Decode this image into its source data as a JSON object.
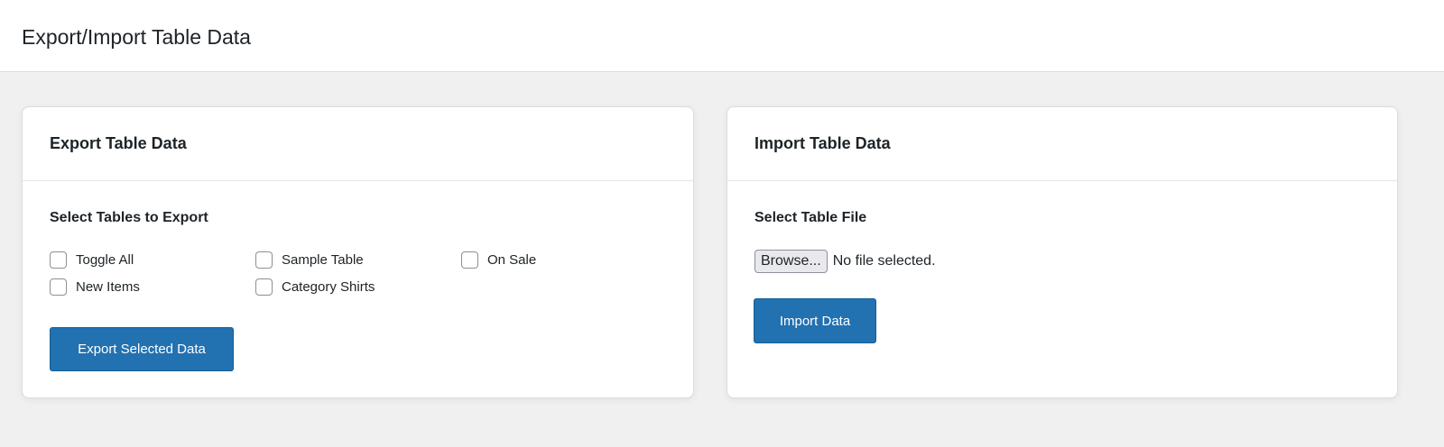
{
  "page_title": "Export/Import Table Data",
  "export": {
    "title": "Export Table Data",
    "section_label": "Select Tables to Export",
    "checkboxes": [
      {
        "label": "Toggle All",
        "checked": false
      },
      {
        "label": "Sample Table",
        "checked": false
      },
      {
        "label": "On Sale",
        "checked": false
      },
      {
        "label": "New Items",
        "checked": false
      },
      {
        "label": "Category Shirts",
        "checked": false
      }
    ],
    "button": "Export Selected Data"
  },
  "import": {
    "title": "Import Table Data",
    "section_label": "Select Table File",
    "browse": "Browse...",
    "file_status": "No file selected.",
    "button": "Import Data"
  }
}
